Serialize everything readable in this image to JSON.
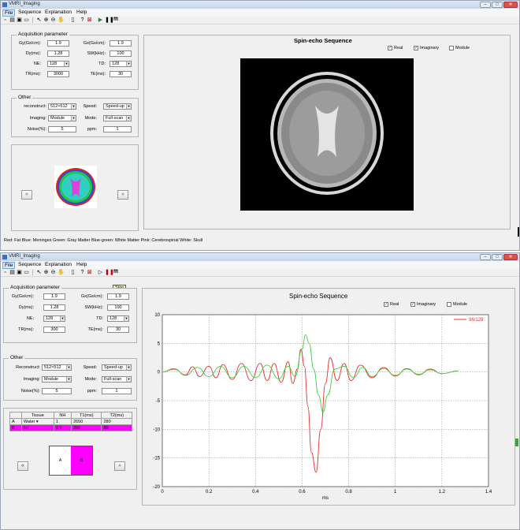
{
  "window": {
    "title": "VMRI_Imaging"
  },
  "menu": [
    "File",
    "Sequence",
    "Explanation",
    "Help"
  ],
  "toolbar": {
    "fft_label": "fft",
    "tooltip": "Stop"
  },
  "acq": {
    "title": "Acquisition parameter",
    "fields": [
      {
        "label": "Gy(Gs/cm):",
        "value": "1.9"
      },
      {
        "label": "Gx(Gs/cm):",
        "value": "1.9"
      },
      {
        "label": "Dy(ms):",
        "value": "1.28"
      },
      {
        "label": "SW(kHz):",
        "value": "100"
      },
      {
        "label": "NE:",
        "value": "128"
      },
      {
        "label": "TD:",
        "value": "128"
      },
      {
        "label": "TR(ms):",
        "value": "3000"
      },
      {
        "label": "TE(ms):",
        "value": "30"
      }
    ],
    "tr2": "300"
  },
  "other": {
    "title": "Other",
    "reconstruct_label": "reconstruct:",
    "reconstruct_label2": "Reconstruct:",
    "reconstruct": "512×512",
    "speed_label": "Speed:",
    "speed": "Speed-up",
    "imaging_label": "Imaging:",
    "imaging": "Module",
    "mode_label": "Mode:",
    "mode": "Full-scan",
    "noise_label": "Noise(%):",
    "noise": "5",
    "ppm_label": "ppm:",
    "ppm": "1"
  },
  "display": {
    "title": "Spin-echo Sequence",
    "checks": [
      {
        "label": "Real",
        "checked": true
      },
      {
        "label": "Imaginary",
        "checked": true
      },
      {
        "label": "Module",
        "checked": false
      }
    ]
  },
  "legend_text": "Red: Fat  Blue: Meninges  Green: Gray Matter  Blue-green: White Matter  Pink: Cerebrospinal  White: Skull",
  "tissue": {
    "headers": [
      "",
      "Tissue",
      "NH",
      "T1(ms)",
      "T2(ms)"
    ],
    "rows": [
      [
        "A",
        "Water",
        "1",
        "2650",
        "280"
      ],
      [
        "B",
        "fat",
        "0.9",
        "260",
        "80"
      ]
    ],
    "swatch_a": "A",
    "swatch_b": "B",
    "swatch_b_color": "#ff00ff"
  },
  "chart_data": {
    "type": "line",
    "xlabel": "ms",
    "xlim": [
      0,
      1.4
    ],
    "ylim": [
      -20,
      10
    ],
    "xticks": [
      "0",
      "0.2",
      "0.4",
      "0.6",
      "0.8",
      "1",
      "1.2",
      "1.4"
    ],
    "yticks": [
      "10",
      "5",
      "0",
      "-5",
      "-10",
      "-15",
      "-20"
    ],
    "legend": "96/128",
    "series": [
      {
        "color": "#e83030",
        "x": [
          0.0,
          0.05,
          0.1,
          0.13,
          0.16,
          0.2,
          0.23,
          0.26,
          0.3,
          0.34,
          0.38,
          0.42,
          0.45,
          0.48,
          0.51,
          0.54,
          0.56,
          0.58,
          0.595,
          0.61,
          0.625,
          0.64,
          0.66,
          0.68,
          0.7,
          0.72,
          0.75,
          0.78,
          0.81,
          0.85,
          0.9,
          0.95,
          1.0,
          1.05,
          1.1,
          1.15,
          1.2,
          1.27
        ],
        "y": [
          0,
          0.5,
          -0.5,
          0.9,
          -0.8,
          1.0,
          -1.0,
          1.3,
          -1.3,
          1.5,
          -1.5,
          1.5,
          -1.5,
          1.5,
          -1.8,
          1.8,
          -2.0,
          0.5,
          4.0,
          1.0,
          -6.0,
          -14.0,
          -17.5,
          -10.0,
          -2.0,
          2.5,
          -1.5,
          1.5,
          -1.5,
          1.2,
          -1.0,
          0.8,
          -0.7,
          0.6,
          -0.5,
          0.5,
          -0.3,
          0.2
        ]
      },
      {
        "color": "#40d040",
        "x": [
          0.0,
          0.05,
          0.1,
          0.15,
          0.2,
          0.25,
          0.3,
          0.35,
          0.4,
          0.45,
          0.5,
          0.54,
          0.57,
          0.6,
          0.615,
          0.63,
          0.65,
          0.67,
          0.69,
          0.71,
          0.74,
          0.78,
          0.82,
          0.86,
          0.9,
          0.95,
          1.0,
          1.05,
          1.1,
          1.15,
          1.2,
          1.27
        ],
        "y": [
          0,
          0.6,
          -0.6,
          0.8,
          -0.8,
          1.0,
          -1.0,
          1.0,
          -1.0,
          1.2,
          -1.2,
          1.0,
          -0.8,
          4.0,
          6.5,
          5.0,
          0.5,
          -4.0,
          -7.0,
          -4.0,
          0.5,
          1.0,
          -1.0,
          0.8,
          -0.8,
          0.6,
          -0.6,
          0.5,
          -0.4,
          0.4,
          -0.3,
          0.2
        ]
      }
    ]
  }
}
